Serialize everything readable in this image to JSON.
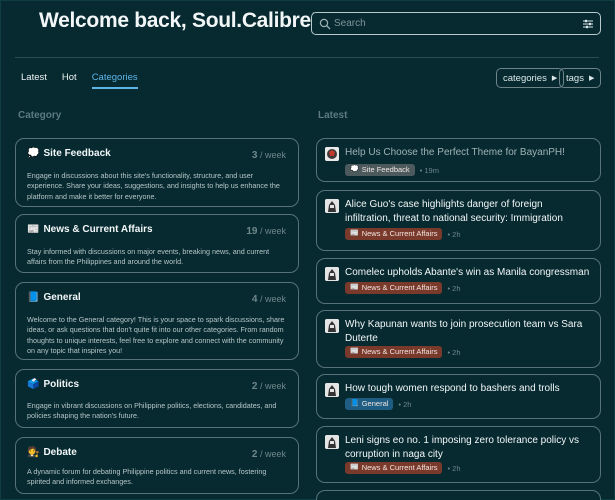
{
  "header": {
    "title": "Welcome back, Soul.Calibre!"
  },
  "search": {
    "placeholder": "Search"
  },
  "tabs": [
    {
      "label": "Latest",
      "active": false
    },
    {
      "label": "Hot",
      "active": false
    },
    {
      "label": "Categories",
      "active": true
    }
  ],
  "filters": {
    "categories": "categories",
    "tags": "tags"
  },
  "columns": {
    "category": "Category",
    "latest": "Latest"
  },
  "categories": [
    {
      "emoji": "💭",
      "name": "Site Feedback",
      "count": "3",
      "per": "/ week",
      "description": "Engage in discussions about this site's functionality, structure, and user experience. Share your ideas, suggestions, and insights to help us enhance the platform and make it better for everyone."
    },
    {
      "emoji": "📰",
      "name": "News & Current Affairs",
      "count": "19",
      "per": "/ week",
      "description": "Stay informed with discussions on major events, breaking news, and current affairs from the Philippines and around the world."
    },
    {
      "emoji": "📘",
      "name": "General",
      "count": "4",
      "per": "/ week",
      "description": "Welcome to the General category! This is your space to spark discussions, share ideas, or ask questions that don't quite fit into our other categories. From random thoughts to unique interests, feel free to explore and connect with the community on any topic that inspires you!"
    },
    {
      "emoji": "🗳️",
      "name": "Politics",
      "count": "2",
      "per": "/ week",
      "description": "Engage in vibrant discussions on Philippine politics, elections, candidates, and policies shaping the nation's future."
    },
    {
      "emoji": "🧑‍⚖️",
      "name": "Debate",
      "count": "2",
      "per": "/ week",
      "description": "A dynamic forum for debating Philippine politics and current news, fostering spirited and informed exchanges."
    }
  ],
  "topics": [
    {
      "title": "Help Us Choose the Perfect Theme for BayanPH!",
      "category": "Site Feedback",
      "time": "19m",
      "read": true
    },
    {
      "title": "Alice Guo's case highlights danger of foreign infiltration, threat to national security: Immigration",
      "category": "News & Current Affairs",
      "time": "2h",
      "read": false
    },
    {
      "title": "Comelec upholds Abante's win as Manila congressman",
      "category": "News & Current Affairs",
      "time": "2h",
      "read": false
    },
    {
      "title": "Why Kapunan wants to join prosecution team vs Sara Duterte",
      "category": "News & Current Affairs",
      "time": "2h",
      "read": false
    },
    {
      "title": "How tough women respond to bashers and trolls",
      "category": "General",
      "time": "2h",
      "read": false
    },
    {
      "title": "Leni signs eo no. 1 imposing zero tolerance policy vs corruption in naga city",
      "category": "News & Current Affairs",
      "time": "2h",
      "read": false
    }
  ],
  "colors": {
    "background": "#062a30",
    "accent": "#5fb4e8",
    "news_badge": "#7a3a2b",
    "general_badge": "#1f5d82"
  }
}
